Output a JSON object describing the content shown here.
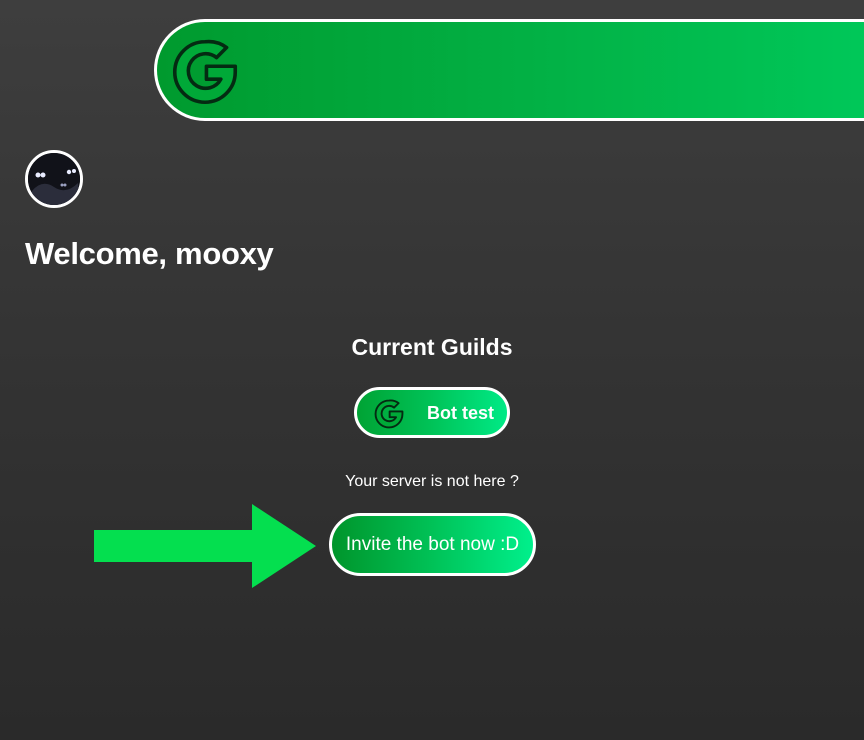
{
  "colors": {
    "accent_green": "#00c358",
    "dark_green": "#00952b",
    "arrow_green": "#04df4f",
    "background": "#333333",
    "text": "#ffffff"
  },
  "header": {
    "logo_icon": "g-logo-icon"
  },
  "user": {
    "avatar_icon": "user-avatar",
    "welcome_text": "Welcome, mooxy"
  },
  "guilds": {
    "title": "Current Guilds",
    "items": [
      {
        "icon": "g-logo-icon",
        "name": "Bot test"
      }
    ]
  },
  "invite": {
    "prompt": "Your server is not here ?",
    "button_label": "Invite the bot now :D",
    "pointer_icon": "arrow-right-icon"
  }
}
